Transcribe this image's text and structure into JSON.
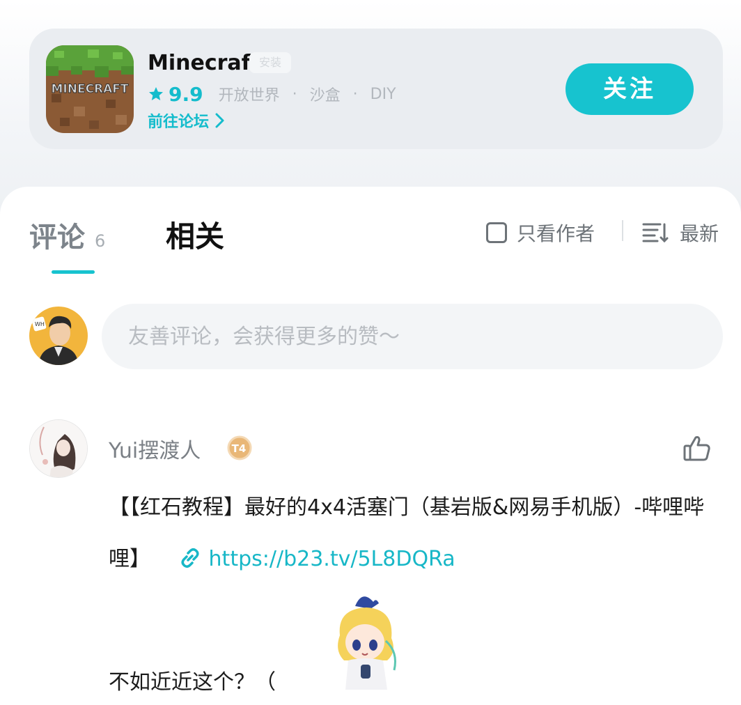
{
  "game": {
    "name": "Minecraft",
    "badge": "安装",
    "icon_label": "MINECRAFT",
    "rating": "9.9",
    "tags": [
      "开放世界",
      "沙盒",
      "DIY"
    ],
    "tag_separator": "·",
    "forum_link": "前往论坛",
    "follow_label": "关注"
  },
  "tabs": {
    "comments_label": "评论",
    "comments_count": "6",
    "related_label": "相关",
    "author_only_label": "只看作者",
    "sort_label": "最新"
  },
  "composer": {
    "placeholder": "友善评论，会获得更多的赞～"
  },
  "comment": {
    "username": "Yui摆渡人",
    "level_badge": "T4",
    "text_before_link": "【【红石教程】最好的4x4活塞门（基岩版&网易手机版）-哔哩哔哩】",
    "link": "https://b23.tv/5L8DQRa",
    "text_line2": "不如近近这个？（"
  },
  "colors": {
    "accent": "#17c3cf",
    "link": "#17b7c7",
    "muted": "#7b8086"
  }
}
